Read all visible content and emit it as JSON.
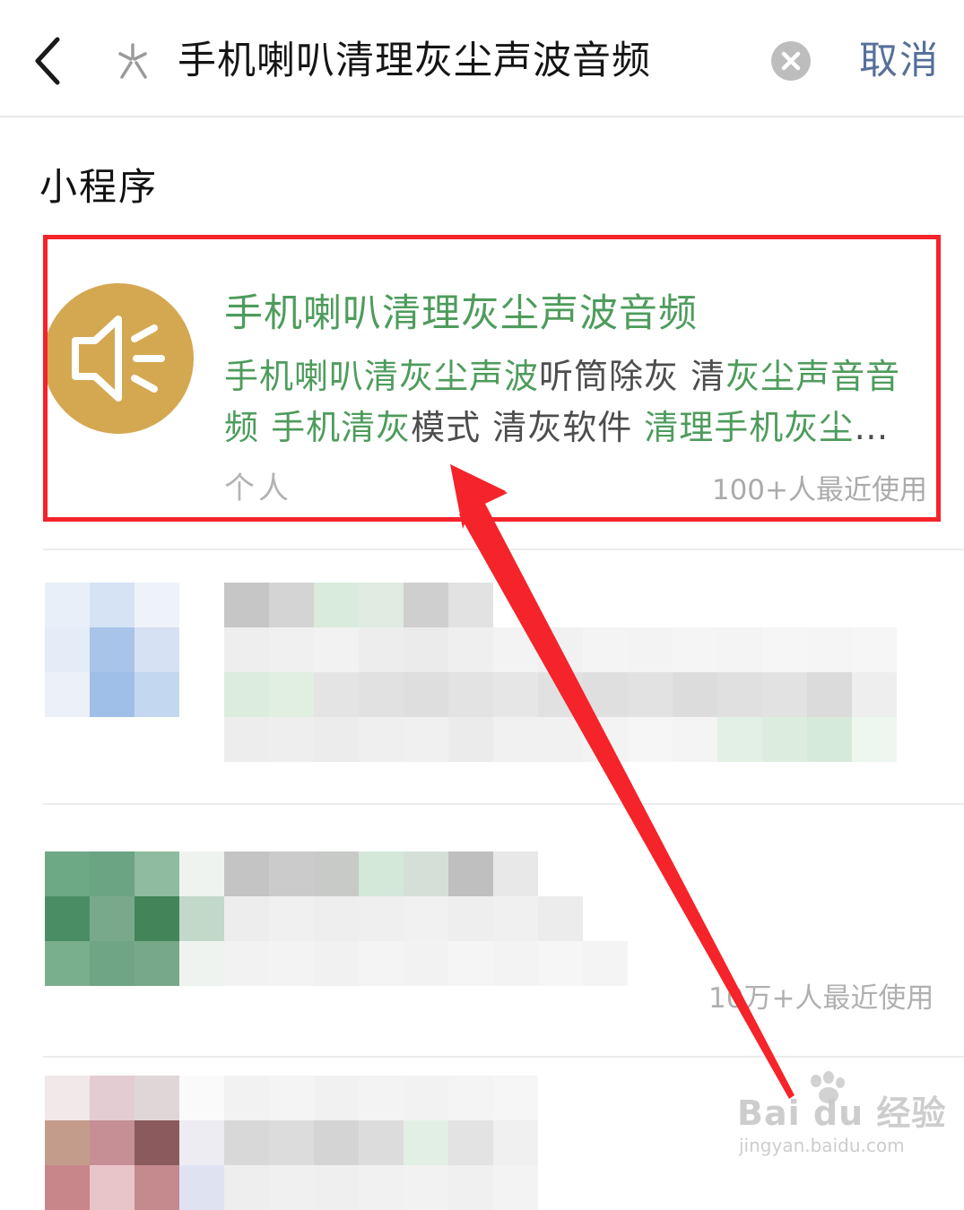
{
  "search": {
    "query": "手机喇叭清理灰尘声波音频",
    "cancel_label": "取消"
  },
  "section": {
    "title": "小程序"
  },
  "result": {
    "name": "手机喇叭清理灰尘声波音频",
    "desc_parts": [
      {
        "text": "手机喇叭清灰尘声波",
        "hl": true
      },
      {
        "text": "听筒除灰 清",
        "hl": false
      },
      {
        "text": "灰尘声音音频",
        "hl": true
      },
      {
        "text": " ",
        "hl": false
      },
      {
        "text": "手机清灰",
        "hl": true
      },
      {
        "text": "模式 清灰软件 ",
        "hl": false
      },
      {
        "text": "清理手机灰尘",
        "hl": true
      },
      {
        "text": "…",
        "hl": false
      }
    ],
    "type": "个人",
    "usage": "100+人最近使用"
  },
  "second_result": {
    "usage": "10万+人最近使用"
  },
  "watermark": {
    "main": "Bai du 经验",
    "sub": "jingyan.baidu.com"
  },
  "colors": {
    "highlight": "#4e9c5c",
    "annotation": "#f5232a",
    "app_icon_bg": "#d4a851",
    "cancel": "#56709a"
  }
}
